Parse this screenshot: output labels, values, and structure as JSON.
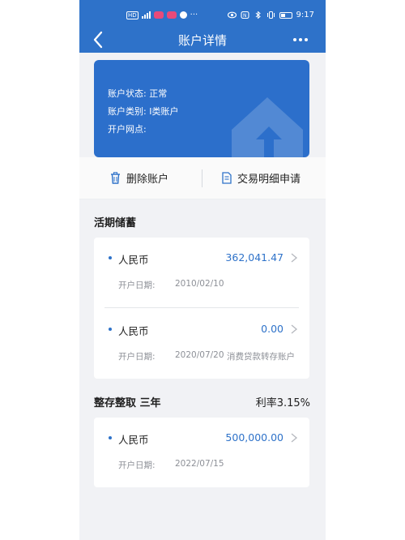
{
  "status_bar": {
    "time": "9:17",
    "left_label": "HD"
  },
  "nav": {
    "title": "账户详情",
    "more_label": "•••"
  },
  "account": {
    "status_label": "账户状态:",
    "status_value": "正常",
    "type_label": "账户类别:",
    "type_value": "I类账户",
    "branch_label": "开户网点:",
    "branch_value": ""
  },
  "actions": {
    "delete_label": "删除账户",
    "transaction_label": "交易明细申请"
  },
  "demand": {
    "title": "活期储蓄",
    "accounts": [
      {
        "currency": "人民币",
        "amount": "362,041.47",
        "date_label": "开户日期:",
        "date": "2010/02/10",
        "note": ""
      },
      {
        "currency": "人民币",
        "amount": "0.00",
        "date_label": "开户日期:",
        "date": "2020/07/20",
        "note": "消费贷款转存账户"
      }
    ]
  },
  "fixed": {
    "title": "整存整取  三年",
    "rate": "利率3.15%",
    "accounts": [
      {
        "currency": "人民币",
        "amount": "500,000.00",
        "date_label": "开户日期:",
        "date": "2022/07/15",
        "note": ""
      }
    ]
  },
  "colors": {
    "brand_blue": "#2e72c9",
    "card_blue": "#2c6fcb",
    "heart_pink": "#e84a7a"
  }
}
